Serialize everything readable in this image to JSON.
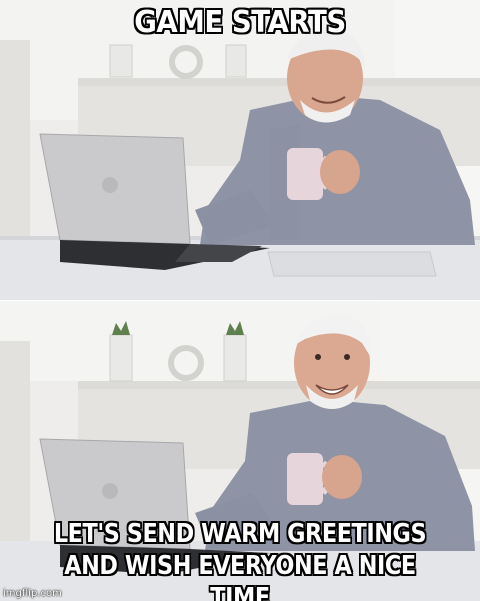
{
  "meme": {
    "top_text": "GAME STARTS",
    "bottom_text": [
      "LET'S SEND WARM GREETINGS",
      "AND WISH EVERYONE A NICE TIME"
    ],
    "watermark": "imgflip.com"
  },
  "colors": {
    "wall": "#ecebe9",
    "desk": "#e6e7e9",
    "shirt": "#8d93a4",
    "skin": "#d9a58f",
    "hair": "#f2f2f2",
    "laptop": "#c9c9cc",
    "mug": "#e5d4da",
    "caption_fill": "#ffffff",
    "caption_stroke": "#000000"
  },
  "panels": [
    {
      "name": "top-panel",
      "expression": "smiling-at-laptop"
    },
    {
      "name": "bottom-panel",
      "expression": "pained-smile-at-camera"
    }
  ]
}
